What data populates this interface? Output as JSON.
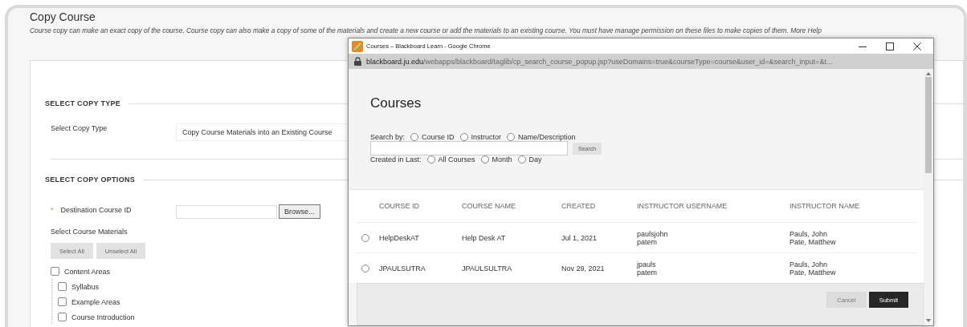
{
  "page": {
    "title": "Copy Course",
    "description": "Course copy can make an exact copy of the course. Course copy can also make a copy of some of the materials and create a new course or add the materials to an existing course. You must have manage permission on these files to make copies of them.",
    "help_link": "More Help"
  },
  "copy_type": {
    "heading": "SELECT COPY TYPE",
    "label": "Select Copy Type",
    "value": "Copy Course Materials into an Existing Course"
  },
  "copy_options": {
    "heading": "SELECT COPY OPTIONS",
    "destination": {
      "label": "Destination Course ID",
      "required_mark": "*",
      "browse": "Browse..."
    },
    "materials_label": "Select Course Materials",
    "buttons": [
      "Select All",
      "Unselect All"
    ],
    "tree": [
      {
        "label": "Content Areas",
        "checked": false,
        "children": [
          {
            "label": "Syllabus",
            "checked": false
          },
          {
            "label": "Example Areas",
            "checked": false
          },
          {
            "label": "Course Introduction",
            "checked": false
          }
        ]
      }
    ]
  },
  "popup": {
    "window_title": "Courses – Blackboard Learn - Google Chrome",
    "url_host": "blackboard.ju.edu",
    "url_path": "/webapps/blackboard/taglib/cp_search_course_popup.jsp?useDomains=true&courseType=course&user_id=&search_input=&t...",
    "heading": "Courses",
    "search_by": {
      "label": "Search by:",
      "options": [
        {
          "label": "Course ID",
          "selected": false
        },
        {
          "label": "Instructor",
          "selected": false
        },
        {
          "label": "Name/Description",
          "selected": false
        }
      ]
    },
    "search_button": "Search",
    "created": {
      "label": "Created in Last:",
      "options": [
        {
          "label": "All Courses",
          "selected": false
        },
        {
          "label": "Month",
          "selected": false
        },
        {
          "label": "Day",
          "selected": false
        }
      ]
    },
    "table": {
      "columns": [
        "COURSE ID",
        "COURSE NAME",
        "CREATED",
        "INSTRUCTOR USERNAME",
        "INSTRUCTOR NAME"
      ],
      "rows": [
        {
          "selected": false,
          "course_id": "HelpDeskAT",
          "course_name": "Help Desk AT",
          "created": "Jul 1, 2021",
          "usernames": [
            "paulsjohn",
            "patem"
          ],
          "names": [
            "Pauls, John",
            "Pate, Matthew"
          ]
        },
        {
          "selected": false,
          "course_id": "JPAULSUTRA",
          "course_name": "JPAULSULTRA",
          "created": "Nov 29, 2021",
          "usernames": [
            "jpauls",
            "patem"
          ],
          "names": [
            "Pauls, John",
            "Pate, Matthew"
          ]
        }
      ]
    },
    "buttons": [
      {
        "label": "Cancel",
        "kind": "secondary"
      },
      {
        "label": "Submit",
        "kind": "primary"
      }
    ]
  }
}
